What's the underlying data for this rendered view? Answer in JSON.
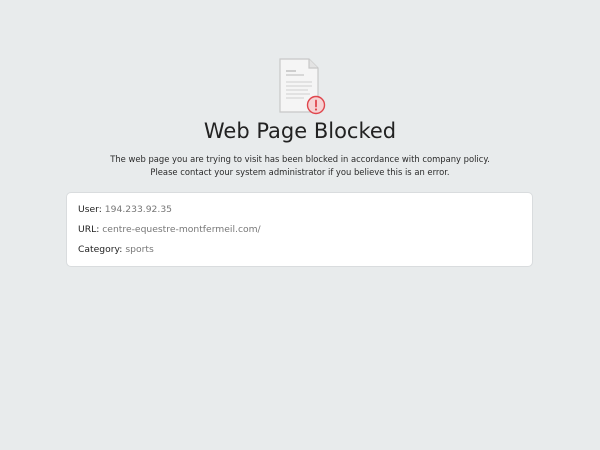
{
  "page": {
    "title": "Web Page Blocked",
    "message": "The web page you are trying to visit has been blocked in accordance with company policy. Please contact your system administrator if you believe this is an error."
  },
  "details": {
    "user_label": "User:",
    "user_value": "194.233.92.35",
    "url_label": "URL:",
    "url_value": "centre-equestre-montfermeil.com/",
    "category_label": "Category:",
    "category_value": "sports"
  },
  "icons": {
    "document": "blocked-document-icon",
    "alert": "alert-icon"
  },
  "colors": {
    "background": "#e8ebec",
    "card": "#ffffff",
    "alert": "#e0464d"
  }
}
